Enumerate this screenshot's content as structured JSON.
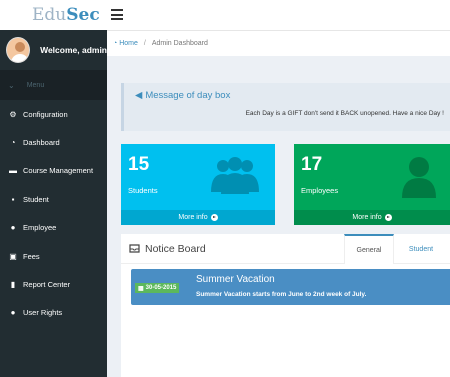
{
  "brand": {
    "part1": "Edu",
    "part2": "Sec"
  },
  "user": {
    "welcome": "Welcome, admin"
  },
  "sidebar": {
    "header": "Menu",
    "items": [
      {
        "label": "Configuration",
        "icon": "gears-icon",
        "glyph": "⚙"
      },
      {
        "label": "Dashboard",
        "icon": "dashboard-icon",
        "glyph": "◔"
      },
      {
        "label": "Course Management",
        "icon": "course-icon",
        "glyph": "▬"
      },
      {
        "label": "Student",
        "icon": "student-icon",
        "glyph": "▪"
      },
      {
        "label": "Employee",
        "icon": "employee-icon",
        "glyph": "●"
      },
      {
        "label": "Fees",
        "icon": "money-icon",
        "glyph": "▣"
      },
      {
        "label": "Report Center",
        "icon": "chart-icon",
        "glyph": "▮"
      },
      {
        "label": "User Rights",
        "icon": "user-icon",
        "glyph": "●"
      }
    ]
  },
  "breadcrumb": {
    "home": "Home",
    "current": "Admin Dashboard"
  },
  "message": {
    "title": "Message of day box",
    "text": "Each Day is a GIFT don't send it BACK unopened. Have a nice Day !"
  },
  "stats": {
    "students": {
      "count": "15",
      "label": "Students",
      "link": "More info",
      "color": "#00c0ef"
    },
    "employees": {
      "count": "17",
      "label": "Employees",
      "link": "More info",
      "color": "#00a65a"
    }
  },
  "notice_board": {
    "title": "Notice Board",
    "tabs": [
      "General",
      "Student"
    ],
    "notice": {
      "date": "30-05-2015",
      "title": "Summer Vacation",
      "body": "Summer Vacation starts from June to 2nd week of July."
    }
  },
  "colors": {
    "accent": "#3c8dbc",
    "sidebar": "#222d32"
  }
}
